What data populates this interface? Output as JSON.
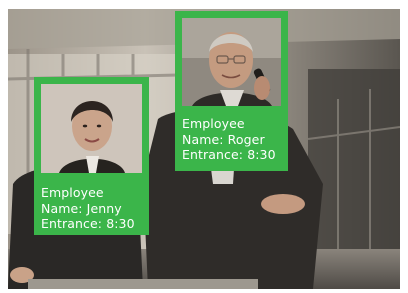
{
  "cards": [
    {
      "title": "Employee",
      "name_line": "Name: Jenny",
      "entrance_line": "Entrance: 8:30"
    },
    {
      "title": "Employee",
      "name_line": "Name: Roger",
      "entrance_line": "Entrance: 8:30"
    }
  ],
  "colors": {
    "card_green": "#3bb54a"
  }
}
